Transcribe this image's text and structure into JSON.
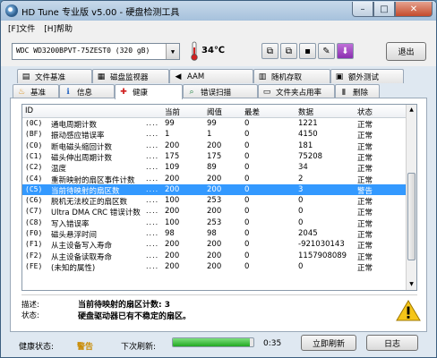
{
  "window": {
    "title": "HD Tune 专业版 v5.00 - 硬盘检测工具",
    "minimize": "–",
    "maximize": "□",
    "close": "✕"
  },
  "menu": [
    {
      "label": "[F]文件"
    },
    {
      "label": "[H]帮助"
    }
  ],
  "toolbar": {
    "drive": "WDC WD3200BPVT-75ZEST0 (320 gB)",
    "temperature": "34℃",
    "icons": [
      "copy-info-icon",
      "copy-screenshot-icon",
      "save-icon",
      "options-icon",
      "download-icon"
    ],
    "exit_label": "退出"
  },
  "tabs_row1": [
    {
      "label": "文件基准",
      "icon": "file-benchmark-icon",
      "glyph": "▤"
    },
    {
      "label": "磁盘监视器",
      "icon": "disk-monitor-icon",
      "glyph": "▦"
    },
    {
      "label": "AAM",
      "icon": "aam-speaker-icon",
      "glyph": "◀"
    },
    {
      "label": "随机存取",
      "icon": "random-access-icon",
      "glyph": "▥"
    },
    {
      "label": "额外测试",
      "icon": "extra-tests-icon",
      "glyph": "▣"
    }
  ],
  "tabs_row2": [
    {
      "label": "基准",
      "icon": "benchmark-icon",
      "glyph": "♨"
    },
    {
      "label": "信息",
      "icon": "info-icon",
      "glyph": "ℹ"
    },
    {
      "label": "健康",
      "icon": "health-cross-icon",
      "glyph": "✚"
    },
    {
      "label": "错误扫描",
      "icon": "error-scan-icon",
      "glyph": "⌕"
    },
    {
      "label": "文件夹占用率",
      "icon": "folder-usage-icon",
      "glyph": "▭"
    },
    {
      "label": "删除",
      "icon": "erase-icon",
      "glyph": "▮"
    }
  ],
  "table": {
    "headers": {
      "id": "ID",
      "current": "当前",
      "threshold": "阈值",
      "worst": "最差",
      "data": "数据",
      "status": "状态"
    },
    "rows": [
      {
        "id": "(0C)",
        "name": "通电周期计数",
        "dots": "....",
        "current": "99",
        "threshold": "99",
        "worst": "0",
        "data": "1221",
        "status": "正常"
      },
      {
        "id": "(BF)",
        "name": "振动感应错误率",
        "dots": "....",
        "current": "1",
        "threshold": "1",
        "worst": "0",
        "data": "4150",
        "status": "正常"
      },
      {
        "id": "(C0)",
        "name": "断电磁头缩回计数",
        "dots": "....",
        "current": "200",
        "threshold": "200",
        "worst": "0",
        "data": "181",
        "status": "正常"
      },
      {
        "id": "(C1)",
        "name": "磁头伸出周期计数",
        "dots": "....",
        "current": "175",
        "threshold": "175",
        "worst": "0",
        "data": "75208",
        "status": "正常"
      },
      {
        "id": "(C2)",
        "name": "温度",
        "dots": "....",
        "current": "109",
        "threshold": "89",
        "worst": "0",
        "data": "34",
        "status": "正常"
      },
      {
        "id": "(C4)",
        "name": "重新映射的扇区事件计数",
        "dots": "....",
        "current": "200",
        "threshold": "200",
        "worst": "0",
        "data": "2",
        "status": "正常"
      },
      {
        "id": "(C5)",
        "name": "当前待映射的扇区数",
        "dots": "....",
        "current": "200",
        "threshold": "200",
        "worst": "0",
        "data": "3",
        "status": "警告",
        "selected": true
      },
      {
        "id": "(C6)",
        "name": "脱机无法校正的扇区数",
        "dots": "....",
        "current": "100",
        "threshold": "253",
        "worst": "0",
        "data": "0",
        "status": "正常"
      },
      {
        "id": "(C7)",
        "name": "Ultra DMA CRC 错误计数",
        "dots": "....",
        "current": "200",
        "threshold": "200",
        "worst": "0",
        "data": "0",
        "status": "正常"
      },
      {
        "id": "(C8)",
        "name": "写入错误率",
        "dots": "....",
        "current": "100",
        "threshold": "253",
        "worst": "0",
        "data": "0",
        "status": "正常"
      },
      {
        "id": "(F0)",
        "name": "磁头悬浮时间",
        "dots": "....",
        "current": "98",
        "threshold": "98",
        "worst": "0",
        "data": "2045",
        "status": "正常"
      },
      {
        "id": "(F1)",
        "name": "从主设备写入寿命",
        "dots": "....",
        "current": "200",
        "threshold": "200",
        "worst": "0",
        "data": "-921030143",
        "status": "正常"
      },
      {
        "id": "(F2)",
        "name": "从主设备读取寿命",
        "dots": "....",
        "current": "200",
        "threshold": "200",
        "worst": "0",
        "data": "1157908089",
        "status": "正常"
      },
      {
        "id": "(FE)",
        "name": "(未知的属性)",
        "dots": "....",
        "current": "200",
        "threshold": "200",
        "worst": "0",
        "data": "0",
        "status": "正常"
      }
    ]
  },
  "details": {
    "desc_label": "描述:",
    "desc_text": "当前待映射的扇区计数: 3",
    "status_label": "状态:",
    "status_text": "硬盘驱动器已有不稳定的扇区。"
  },
  "statusbar": {
    "health_label": "健康状态:",
    "health_value": "警告",
    "next_refresh_label": "下次刷新:",
    "refresh_progress": 0.95,
    "countdown": "0:35",
    "refresh_button": "立即刷新",
    "log_button": "日志"
  },
  "colors": {
    "selection": "#3399ff",
    "warning": "#c98a00",
    "progress": "#22a822"
  }
}
